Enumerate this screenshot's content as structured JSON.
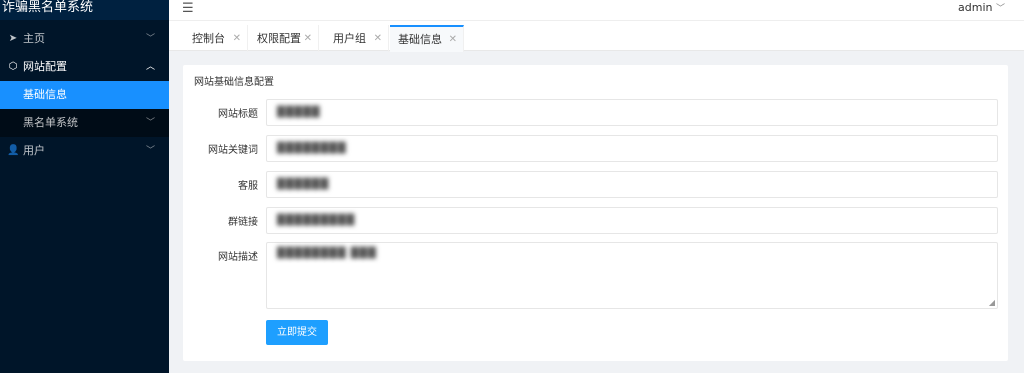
{
  "sidebar": {
    "logo": "诈骗黑名单系统",
    "items": [
      {
        "label": "主页",
        "icon": "send-icon"
      },
      {
        "label": "网站配置",
        "icon": "settings-icon",
        "open": true,
        "children": [
          {
            "label": "基础信息",
            "active": true
          },
          {
            "label": "黑名单系统"
          }
        ]
      },
      {
        "label": "用户",
        "icon": "user-icon"
      }
    ]
  },
  "topbar": {
    "fold_icon": "menu-fold-icon",
    "user": "admin"
  },
  "tabs": [
    {
      "label": "控制台"
    },
    {
      "label": "权限配置"
    },
    {
      "label": "用户组"
    },
    {
      "label": "基础信息",
      "active": true
    }
  ],
  "form": {
    "title": "网站基础信息配置",
    "fields": [
      {
        "label": "网站标题",
        "value": "█████"
      },
      {
        "label": "网站关键词",
        "value": "████████"
      },
      {
        "label": "客服",
        "value": "██████"
      },
      {
        "label": "群链接",
        "value": "█████████"
      },
      {
        "label": "网站描述",
        "value": "████████ ███"
      }
    ],
    "submit_label": "立即提交"
  },
  "colors": {
    "sidebar_bg": "#001529",
    "active_item": "#1890ff",
    "submit_button": "#1e9fff"
  }
}
